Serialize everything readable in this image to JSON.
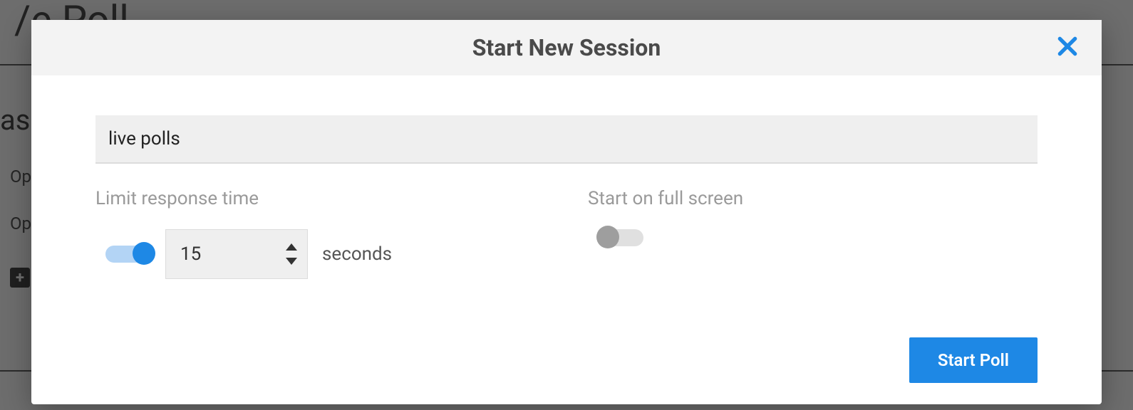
{
  "background": {
    "title_fragment": "/e Poll",
    "as_fragment": "as",
    "option1_fragment": "Op",
    "option2_fragment": "Op"
  },
  "modal": {
    "title": "Start New Session",
    "session_name": "live polls",
    "limit_response": {
      "label": "Limit response time",
      "enabled": true,
      "value": "15",
      "unit": "seconds"
    },
    "fullscreen": {
      "label": "Start on full screen",
      "enabled": false
    },
    "start_button": "Start Poll"
  }
}
